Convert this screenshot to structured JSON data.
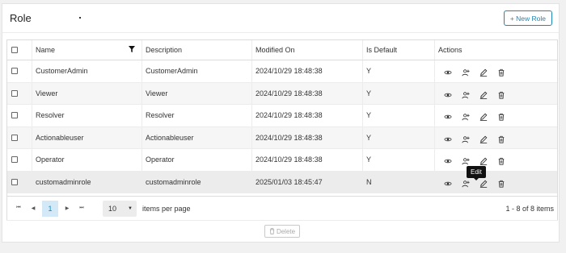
{
  "header": {
    "title": "Role",
    "new_role_label": "+ New Role"
  },
  "columns": [
    "Name",
    "Description",
    "Modified On",
    "Is Default",
    "Actions"
  ],
  "rows": [
    {
      "name": "CustomerAdmin",
      "description": "CustomerAdmin",
      "modified": "2024/10/29 18:48:38",
      "is_default": "Y"
    },
    {
      "name": "Viewer",
      "description": "Viewer",
      "modified": "2024/10/29 18:48:38",
      "is_default": "Y"
    },
    {
      "name": "Resolver",
      "description": "Resolver",
      "modified": "2024/10/29 18:48:38",
      "is_default": "Y"
    },
    {
      "name": "Actionableuser",
      "description": "Actionableuser",
      "modified": "2024/10/29 18:48:38",
      "is_default": "Y"
    },
    {
      "name": "Operator",
      "description": "Operator",
      "modified": "2024/10/29 18:48:38",
      "is_default": "Y"
    },
    {
      "name": "customadminrole",
      "description": "customadminrole",
      "modified": "2025/01/03 18:45:47",
      "is_default": "N"
    }
  ],
  "tooltip": "Edit",
  "pager": {
    "first": "⏮",
    "prev": "◀",
    "next": "▶",
    "last": "⏭",
    "current_page": "1",
    "page_size": "10",
    "page_size_caret": "▼",
    "items_per_page_label": "items per page",
    "info": "1 - 8 of 8 items"
  },
  "footer": {
    "delete_label": "Delete"
  },
  "icons": {
    "filter": "filter-icon",
    "view": "eye-icon",
    "assign": "user-add-icon",
    "edit": "pencil-icon",
    "delete": "trash-icon",
    "page_nav": "arrow-icons"
  },
  "colors": {
    "accent": "#1f87b7",
    "page_bg": "#f1f1f1",
    "alt_row": "#f6f6f6",
    "pager_active": "#d3e9f8"
  }
}
